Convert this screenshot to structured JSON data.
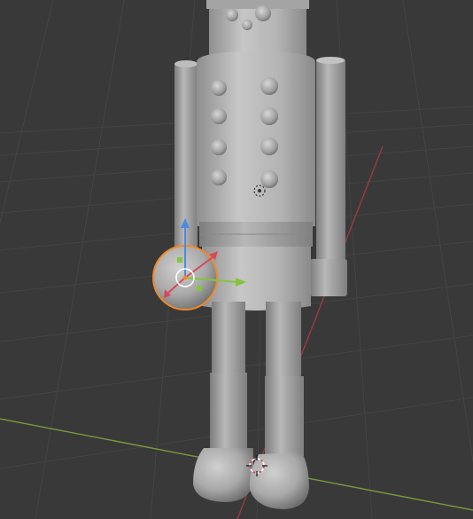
{
  "viewport": {
    "background_color": "#393939",
    "grid_color": "#444444",
    "x_axis_color": "#7b9a3c",
    "y_axis_color": "#9b3a44",
    "selection_color": "#f0892a",
    "model_color": "#b5b5b5"
  },
  "scene": {
    "model": "nutcracker-figure",
    "selected_object": "sphere",
    "gizmo": "move-gizmo",
    "origin_marker": "3d-cursor"
  },
  "gizmo": {
    "x_color": "#d9475a",
    "y_color": "#86c43d",
    "z_color": "#4b8ce0"
  }
}
